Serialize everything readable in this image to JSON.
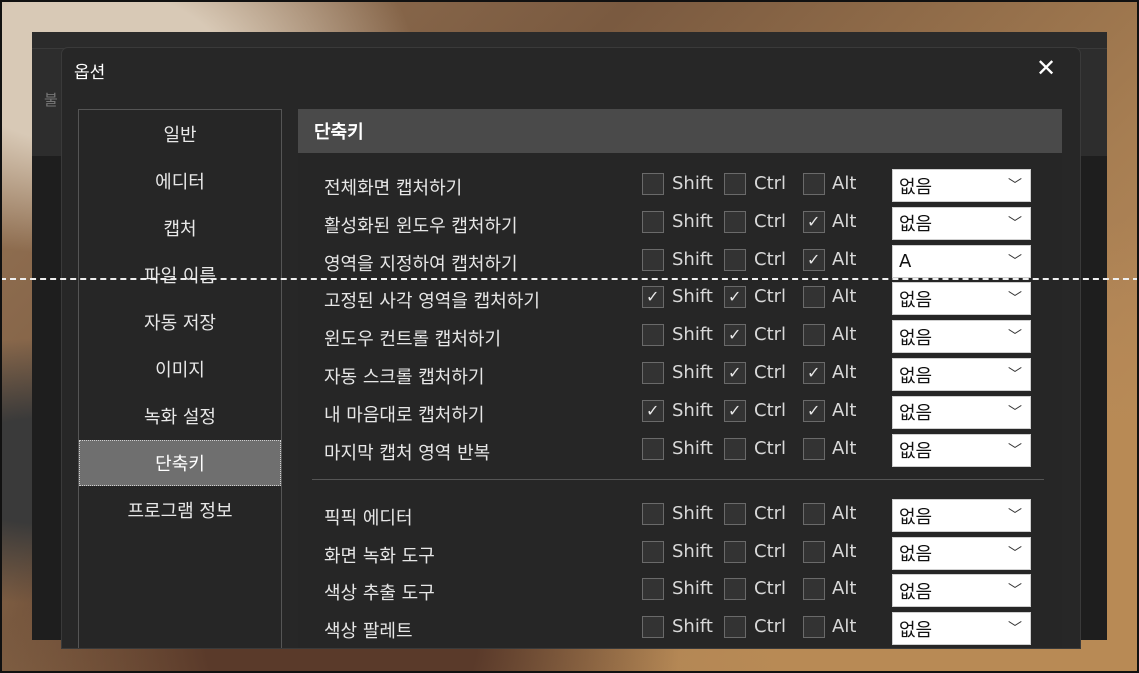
{
  "dialog": {
    "title": "옵션",
    "close_glyph": "✕"
  },
  "background_app": {
    "side_text": "불"
  },
  "sidebar": {
    "items": [
      {
        "label": "일반",
        "active": false
      },
      {
        "label": "에디터",
        "active": false
      },
      {
        "label": "캡처",
        "active": false
      },
      {
        "label": "파일 이름",
        "active": false
      },
      {
        "label": "자동 저장",
        "active": false
      },
      {
        "label": "이미지",
        "active": false
      },
      {
        "label": "녹화 설정",
        "active": false
      },
      {
        "label": "단축키",
        "active": true
      },
      {
        "label": "프로그램 정보",
        "active": false
      }
    ]
  },
  "shortcuts": {
    "header": "단축키",
    "modifier_labels": {
      "shift": "Shift",
      "ctrl": "Ctrl",
      "alt": "Alt"
    },
    "check_glyph": "✓",
    "chevron_icon": "chevron-down-icon",
    "rows": [
      {
        "label": "전체화면 캡처하기",
        "shift": false,
        "ctrl": false,
        "alt": false,
        "key": "없음"
      },
      {
        "label": "활성화된 윈도우 캡처하기",
        "shift": false,
        "ctrl": false,
        "alt": true,
        "key": "없음"
      },
      {
        "label": "영역을 지정하여 캡처하기",
        "shift": false,
        "ctrl": false,
        "alt": true,
        "key": "A"
      },
      {
        "label": "고정된 사각 영역을 캡처하기",
        "shift": true,
        "ctrl": true,
        "alt": false,
        "key": "없음"
      },
      {
        "label": "윈도우 컨트롤 캡처하기",
        "shift": false,
        "ctrl": true,
        "alt": false,
        "key": "없음"
      },
      {
        "label": "자동 스크롤 캡처하기",
        "shift": false,
        "ctrl": true,
        "alt": true,
        "key": "없음"
      },
      {
        "label": "내 마음대로 캡처하기",
        "shift": true,
        "ctrl": true,
        "alt": true,
        "key": "없음"
      },
      {
        "label": "마지막 캡처 영역 반복",
        "shift": false,
        "ctrl": false,
        "alt": false,
        "key": "없음"
      }
    ],
    "tool_rows": [
      {
        "label": "픽픽 에디터",
        "shift": false,
        "ctrl": false,
        "alt": false,
        "key": "없음"
      },
      {
        "label": "화면 녹화 도구",
        "shift": false,
        "ctrl": false,
        "alt": false,
        "key": "없음"
      },
      {
        "label": "색상 추출 도구",
        "shift": false,
        "ctrl": false,
        "alt": false,
        "key": "없음"
      },
      {
        "label": "색상 팔레트",
        "shift": false,
        "ctrl": false,
        "alt": false,
        "key": "없음"
      }
    ]
  }
}
